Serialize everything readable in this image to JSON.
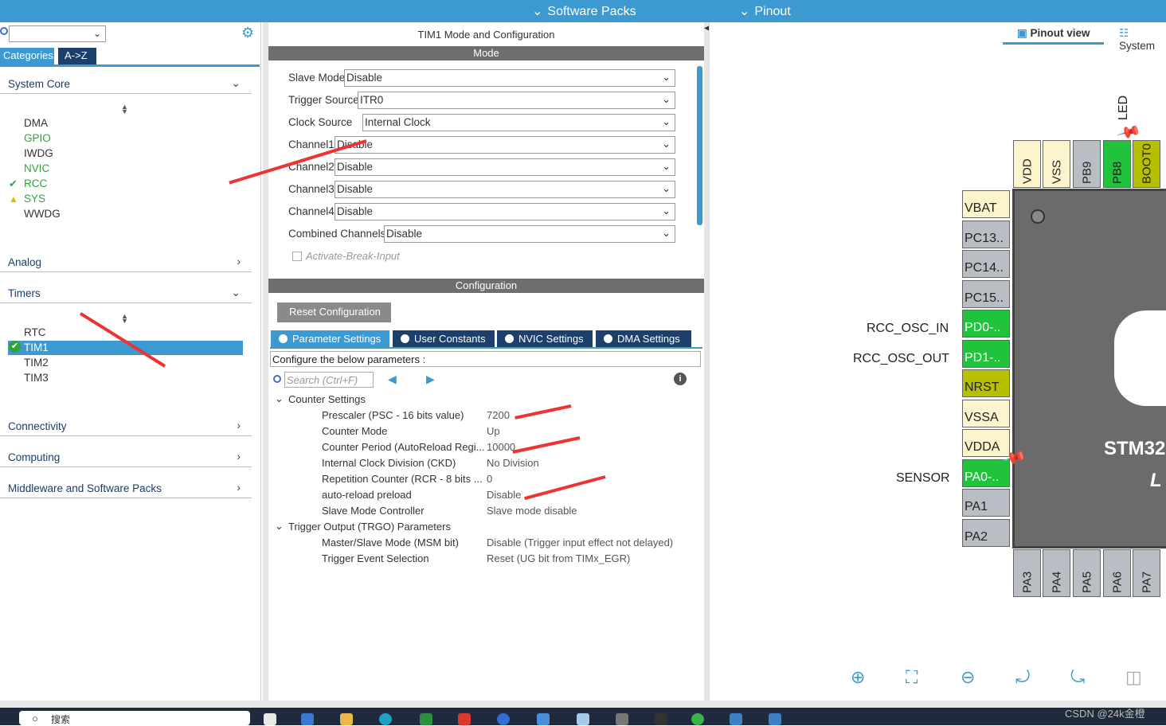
{
  "topbar": {
    "software_packs": "Software Packs",
    "pinout": "Pinout"
  },
  "left": {
    "tabs": [
      "Categories",
      "A->Z"
    ],
    "sections": {
      "system_core": "System Core",
      "analog": "Analog",
      "timers": "Timers",
      "connectivity": "Connectivity",
      "computing": "Computing",
      "middleware": "Middleware and Software Packs"
    },
    "system_core_items": [
      "DMA",
      "GPIO",
      "IWDG",
      "NVIC",
      "RCC",
      "SYS",
      "WWDG"
    ],
    "timer_items": [
      "RTC",
      "TIM1",
      "TIM2",
      "TIM3"
    ]
  },
  "mid": {
    "title": "TIM1 Mode and Configuration",
    "mode_band": "Mode",
    "config_band": "Configuration",
    "fields": [
      {
        "label": "Slave Mode",
        "value": "Disable"
      },
      {
        "label": "Trigger Source",
        "value": "ITR0"
      },
      {
        "label": "Clock Source",
        "value": "Internal Clock"
      },
      {
        "label": "Channel1",
        "value": "Disable"
      },
      {
        "label": "Channel2",
        "value": "Disable"
      },
      {
        "label": "Channel3",
        "value": "Disable"
      },
      {
        "label": "Channel4",
        "value": "Disable"
      },
      {
        "label": "Combined Channels",
        "value": "Disable"
      }
    ],
    "activate_break": "Activate-Break-Input",
    "reset_config": "Reset Configuration",
    "param_tabs": [
      "Parameter Settings",
      "User Constants",
      "NVIC Settings",
      "DMA Settings"
    ],
    "configure_text": "Configure the below parameters :",
    "search_placeholder": "Search (Ctrl+F)",
    "counter_settings": "Counter Settings",
    "params": [
      {
        "name": "Prescaler (PSC - 16 bits value)",
        "value": "7200"
      },
      {
        "name": "Counter Mode",
        "value": "Up"
      },
      {
        "name": "Counter Period (AutoReload Regi...",
        "value": "10000"
      },
      {
        "name": "Internal Clock Division (CKD)",
        "value": "No Division"
      },
      {
        "name": "Repetition Counter (RCR - 8 bits ...",
        "value": "0"
      },
      {
        "name": "auto-reload preload",
        "value": "Disable"
      },
      {
        "name": "Slave Mode Controller",
        "value": "Slave mode disable"
      }
    ],
    "trgo_settings": "Trigger Output (TRGO) Parameters",
    "trgo_params": [
      {
        "name": "Master/Slave Mode (MSM bit)",
        "value": "Disable (Trigger input effect not delayed)"
      },
      {
        "name": "Trigger Event Selection",
        "value": "Reset (UG bit from TIMx_EGR)"
      }
    ]
  },
  "right": {
    "pinout_view": "Pinout view",
    "system_view": "System",
    "top_pins": [
      "VDD",
      "VSS",
      "PB9",
      "PB8",
      "BOOT0"
    ],
    "led_label": "LED",
    "left_pins": [
      "VBAT",
      "PC13..",
      "PC14..",
      "PC15..",
      "PD0-..",
      "PD1-..",
      "NRST",
      "VSSA",
      "VDDA",
      "PA0-..",
      "PA1",
      "PA2"
    ],
    "bottom_pins": [
      "PA3",
      "PA4",
      "PA5",
      "PA6",
      "PA7"
    ],
    "signals": {
      "osc_in": "RCC_OSC_IN",
      "osc_out": "RCC_OSC_OUT",
      "sensor": "SENSOR"
    },
    "chip_name": "STM32",
    "chip_sub": "L"
  },
  "taskbar": {
    "search_text": "搜索",
    "watermark": "CSDN @24k金橙"
  },
  "colors": {
    "accent": "#3d9ad1",
    "pin_green": "#21c23c",
    "pin_yellow": "#b6c000",
    "pin_cream": "#fcf4cc",
    "pin_grey": "#b9bec4",
    "annotation_red": "#ee3333"
  }
}
